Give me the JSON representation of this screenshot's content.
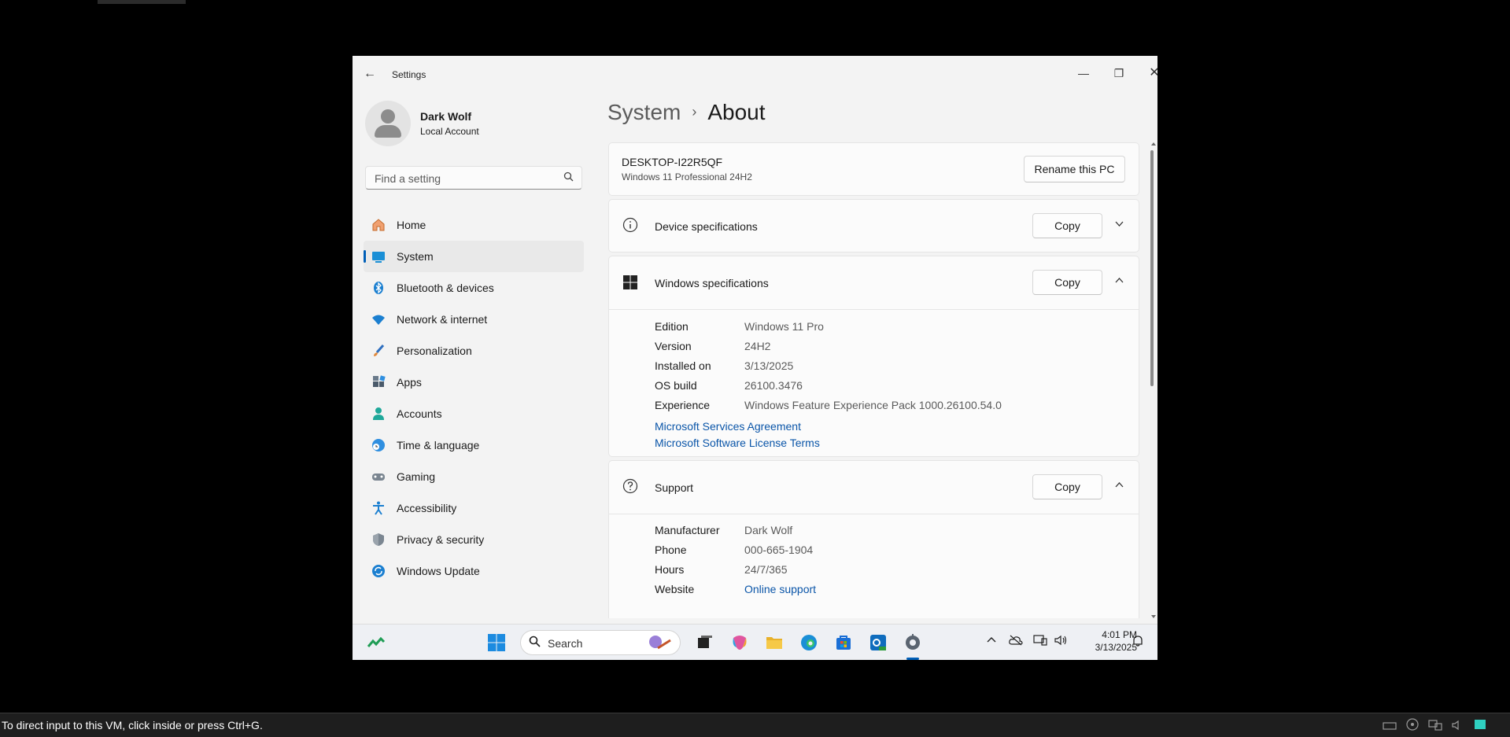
{
  "window": {
    "title": "Settings",
    "back_icon": "←",
    "minimize": "—",
    "restore": "❐",
    "close": "✕"
  },
  "profile": {
    "name": "Dark Wolf",
    "type": "Local Account"
  },
  "search": {
    "placeholder": "Find a setting"
  },
  "nav": {
    "items": [
      {
        "label": "Home",
        "icon": "home-icon"
      },
      {
        "label": "System",
        "icon": "system-icon",
        "selected": true
      },
      {
        "label": "Bluetooth & devices",
        "icon": "bluetooth-icon"
      },
      {
        "label": "Network & internet",
        "icon": "wifi-icon"
      },
      {
        "label": "Personalization",
        "icon": "brush-icon"
      },
      {
        "label": "Apps",
        "icon": "apps-icon"
      },
      {
        "label": "Accounts",
        "icon": "person-icon"
      },
      {
        "label": "Time & language",
        "icon": "globe-clock-icon"
      },
      {
        "label": "Gaming",
        "icon": "gamepad-icon"
      },
      {
        "label": "Accessibility",
        "icon": "accessibility-icon"
      },
      {
        "label": "Privacy & security",
        "icon": "shield-icon"
      },
      {
        "label": "Windows Update",
        "icon": "update-icon"
      }
    ]
  },
  "breadcrumb": {
    "parent": "System",
    "separator": "›",
    "current": "About"
  },
  "pc": {
    "name": "DESKTOP-I22R5QF",
    "edition": "Windows 11 Professional 24H2",
    "rename_label": "Rename this PC"
  },
  "device_specs": {
    "title": "Device specifications",
    "copy_label": "Copy",
    "expanded": false
  },
  "windows_specs": {
    "title": "Windows specifications",
    "copy_label": "Copy",
    "expanded": true,
    "rows": [
      {
        "key": "Edition",
        "value": "Windows 11 Pro"
      },
      {
        "key": "Version",
        "value": "24H2"
      },
      {
        "key": "Installed on",
        "value": "3/13/2025"
      },
      {
        "key": "OS build",
        "value": "26100.3476"
      },
      {
        "key": "Experience",
        "value": "Windows Feature Experience Pack 1000.26100.54.0"
      }
    ],
    "links": [
      "Microsoft Services Agreement",
      "Microsoft Software License Terms"
    ]
  },
  "support": {
    "title": "Support",
    "copy_label": "Copy",
    "expanded": true,
    "rows": [
      {
        "key": "Manufacturer",
        "value": "Dark Wolf"
      },
      {
        "key": "Phone",
        "value": "000-665-1904"
      },
      {
        "key": "Hours",
        "value": "24/7/365"
      },
      {
        "key": "Website",
        "value": "Online support"
      }
    ]
  },
  "taskbar": {
    "search_label": "Search",
    "time": "4:01 PM",
    "date": "3/13/2025"
  },
  "vm_status": {
    "message": "To direct input to this VM, click inside or press Ctrl+G."
  },
  "colors": {
    "accent": "#005fb8",
    "link": "#0a55a8"
  }
}
